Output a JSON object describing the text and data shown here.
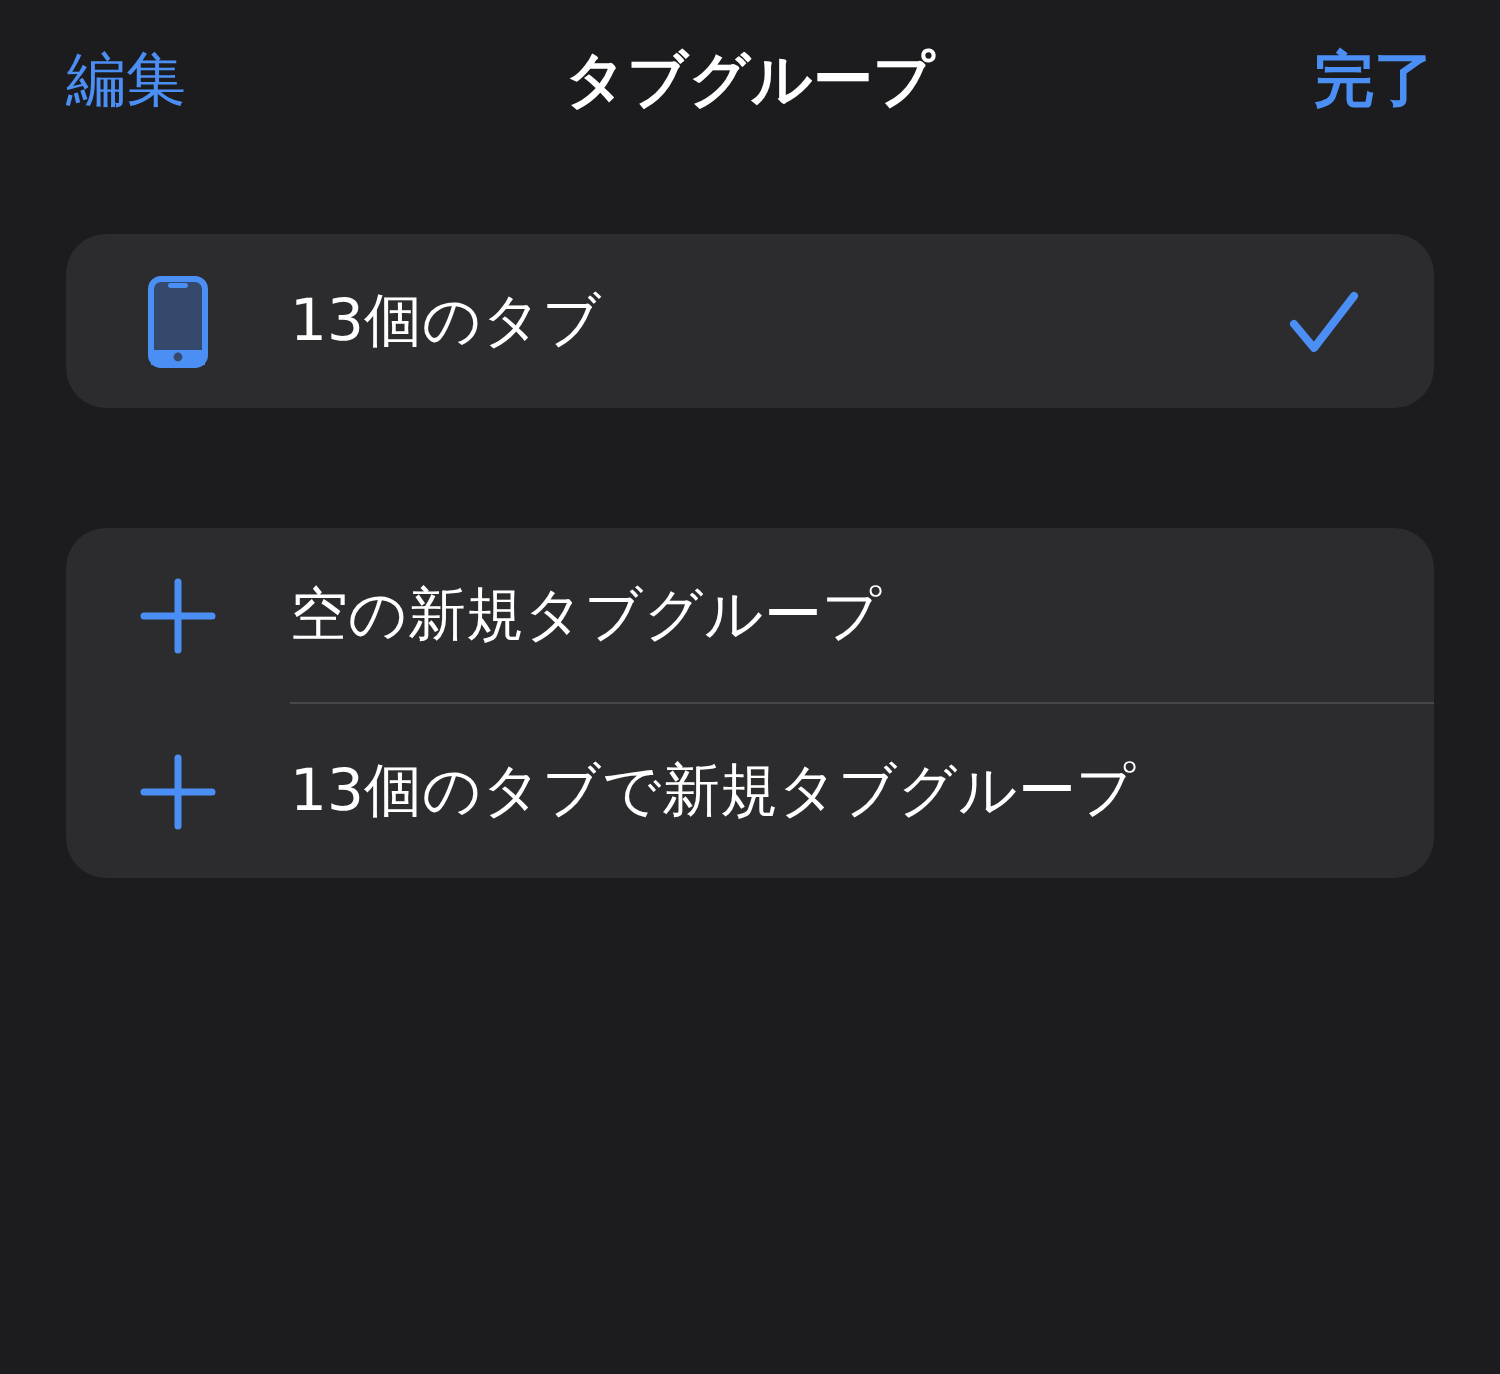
{
  "nav_bar": {
    "edit_button": "編集",
    "title": "タブグループ",
    "done_button": "完了"
  },
  "tab_groups": [
    {
      "label": "13個のタブ",
      "selected": true
    }
  ],
  "actions": [
    {
      "label": "空の新規タブグループ"
    },
    {
      "label": "13個のタブで新規タブグループ"
    }
  ]
}
